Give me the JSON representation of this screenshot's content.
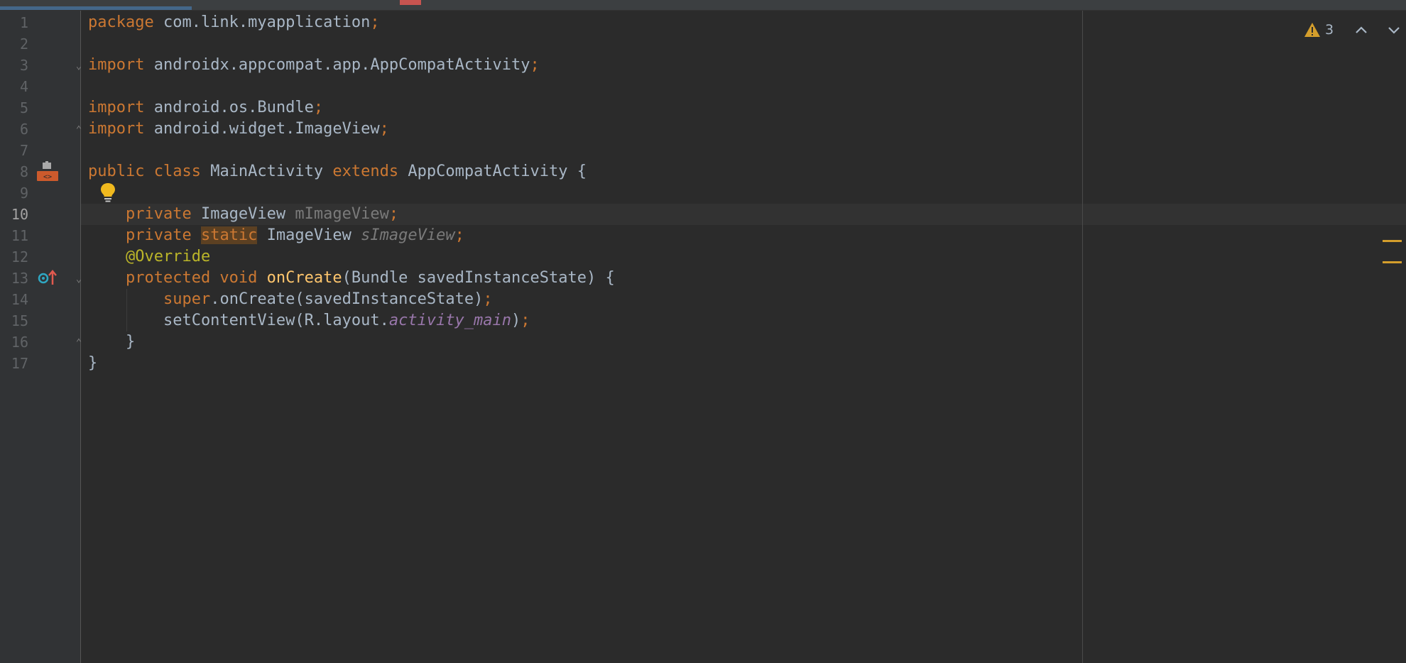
{
  "editor": {
    "lines": [
      {
        "number": "1",
        "tokens": [
          {
            "text": "package",
            "style": "kw"
          },
          {
            "text": " com.link.myapplication",
            "style": "plain"
          },
          {
            "text": ";",
            "style": "semi"
          }
        ]
      },
      {
        "number": "2",
        "tokens": []
      },
      {
        "number": "3",
        "tokens": [
          {
            "text": "import",
            "style": "kw"
          },
          {
            "text": " androidx.appcompat.app.AppCompatActivity",
            "style": "plain"
          },
          {
            "text": ";",
            "style": "semi"
          }
        ]
      },
      {
        "number": "4",
        "tokens": []
      },
      {
        "number": "5",
        "tokens": [
          {
            "text": "import",
            "style": "kw"
          },
          {
            "text": " android.os.Bundle",
            "style": "plain"
          },
          {
            "text": ";",
            "style": "semi"
          }
        ]
      },
      {
        "number": "6",
        "tokens": [
          {
            "text": "import",
            "style": "kw"
          },
          {
            "text": " android.widget.ImageView",
            "style": "plain"
          },
          {
            "text": ";",
            "style": "semi"
          }
        ]
      },
      {
        "number": "7",
        "tokens": []
      },
      {
        "number": "8",
        "tokens": [
          {
            "text": "public class",
            "style": "kw"
          },
          {
            "text": " MainActivity ",
            "style": "plain"
          },
          {
            "text": "extends",
            "style": "kw"
          },
          {
            "text": " AppCompatActivity {",
            "style": "plain"
          }
        ]
      },
      {
        "number": "9",
        "tokens": []
      },
      {
        "number": "10",
        "tokens": [
          {
            "text": "    ",
            "style": "plain"
          },
          {
            "text": "private",
            "style": "kw"
          },
          {
            "text": " ImageView ",
            "style": "plain"
          },
          {
            "text": "mImageView",
            "style": "unused"
          },
          {
            "text": ";",
            "style": "semi"
          }
        ]
      },
      {
        "number": "11",
        "tokens": [
          {
            "text": "    ",
            "style": "plain"
          },
          {
            "text": "private",
            "style": "kw"
          },
          {
            "text": " ",
            "style": "plain"
          },
          {
            "text": "static",
            "style": "kw warn-highlight"
          },
          {
            "text": " ImageView ",
            "style": "plain"
          },
          {
            "text": "sImageView",
            "style": "unused-static"
          },
          {
            "text": ";",
            "style": "semi"
          }
        ]
      },
      {
        "number": "12",
        "tokens": [
          {
            "text": "    ",
            "style": "plain"
          },
          {
            "text": "@Override",
            "style": "annotation"
          }
        ]
      },
      {
        "number": "13",
        "tokens": [
          {
            "text": "    ",
            "style": "plain"
          },
          {
            "text": "protected void",
            "style": "kw"
          },
          {
            "text": " ",
            "style": "plain"
          },
          {
            "text": "onCreate",
            "style": "method-decl"
          },
          {
            "text": "(Bundle savedInstanceState) {",
            "style": "plain"
          }
        ]
      },
      {
        "number": "14",
        "tokens": [
          {
            "text": "        ",
            "style": "plain"
          },
          {
            "text": "super",
            "style": "kw"
          },
          {
            "text": ".onCreate(savedInstanceState)",
            "style": "plain"
          },
          {
            "text": ";",
            "style": "semi"
          }
        ]
      },
      {
        "number": "15",
        "tokens": [
          {
            "text": "        setContentView(R.layout.",
            "style": "plain"
          },
          {
            "text": "activity_main",
            "style": "constant-ref"
          },
          {
            "text": ")",
            "style": "plain"
          },
          {
            "text": ";",
            "style": "semi"
          }
        ]
      },
      {
        "number": "16",
        "tokens": [
          {
            "text": "    }",
            "style": "plain"
          }
        ]
      },
      {
        "number": "17",
        "tokens": [
          {
            "text": "}",
            "style": "plain"
          }
        ]
      }
    ],
    "current_line": "10"
  },
  "inspections": {
    "warning_count": "3",
    "warning_icon": "warning-triangle-icon",
    "prev_icon": "chevron-up-icon",
    "next_icon": "chevron-down-icon"
  },
  "colors": {
    "background": "#2b2b2b",
    "gutter": "#313335",
    "keyword": "#cc7832",
    "identifier": "#a9b7c6",
    "unused": "#7a7a7a",
    "annotation": "#bbb529",
    "method_declaration": "#ffc66d",
    "constant": "#9876aa",
    "warning": "#d49e2c"
  }
}
